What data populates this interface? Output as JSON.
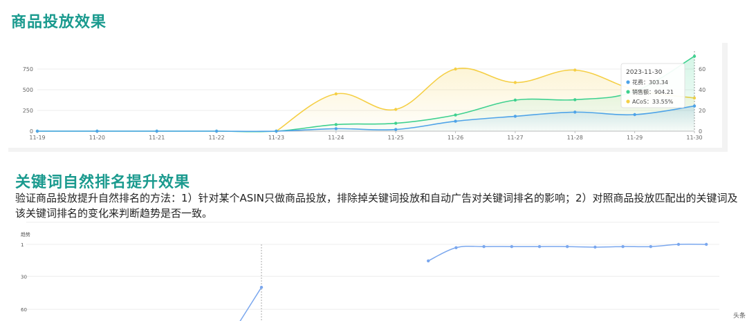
{
  "section1": {
    "title": "商品投放效果"
  },
  "section2": {
    "title": "关键词自然排名提升效果",
    "description": "验证商品投放提升自然排名的方法：1）针对某个ASIN只做商品投放，排除掉关键词投放和自动广告对关键词排名的影响；2）对照商品投放匹配出的关键词及该关键词排名的变化来判断趋势是否一致。"
  },
  "watermark": "头条",
  "colors": {
    "title": "#1a9a8e",
    "spend": "#4ea3e8",
    "sales": "#3ed18f",
    "acos": "#f5cf45",
    "rank": "#7aa7ee"
  },
  "chart_data": [
    {
      "type": "line",
      "categories": [
        "11-19",
        "11-20",
        "11-21",
        "11-22",
        "11-23",
        "11-24",
        "11-25",
        "11-26",
        "11-27",
        "11-28",
        "11-29",
        "11-30"
      ],
      "series": [
        {
          "name": "花费",
          "axis": "left",
          "color": "#4ea3e8",
          "values": [
            0,
            0,
            0,
            0,
            0,
            30,
            20,
            120,
            180,
            230,
            200,
            303.34
          ]
        },
        {
          "name": "销售额",
          "axis": "left",
          "color": "#3ed18f",
          "values": [
            0,
            0,
            0,
            0,
            0,
            80,
            95,
            195,
            375,
            380,
            480,
            904.21
          ]
        },
        {
          "name": "ACoS",
          "axis": "right",
          "color": "#f5cf45",
          "values": [
            null,
            null,
            null,
            null,
            0,
            36,
            21,
            60,
            47,
            59,
            40,
            32
          ]
        }
      ],
      "left_axis": {
        "ticks": [
          0,
          250,
          500,
          750
        ],
        "ylim": [
          0,
          900
        ]
      },
      "right_axis": {
        "ticks": [
          0,
          20,
          40,
          60
        ],
        "ylim": [
          0,
          72
        ]
      },
      "tooltip": {
        "date": "2023-11-30",
        "rows": [
          {
            "label": "花费：",
            "value": "303.34",
            "color": "#4ea3e8"
          },
          {
            "label": "销售额：",
            "value": "904.21",
            "color": "#3ed18f"
          },
          {
            "label": "ACoS：",
            "value": "33.55%",
            "color": "#f5cf45"
          }
        ]
      },
      "grid": true
    },
    {
      "type": "line",
      "ylabel": "趋势",
      "y_ticks": [
        1,
        30,
        60
      ],
      "ylim_inverted": [
        1,
        80
      ],
      "series": [
        {
          "name": "",
          "color": "#7aa7ee",
          "segment": "a",
          "points": [
            [
              0,
              80
            ],
            [
              1,
              40
            ]
          ]
        },
        {
          "name": "",
          "color": "#7aa7ee",
          "segment": "b",
          "points": [
            [
              7,
              16
            ],
            [
              8,
              4
            ],
            [
              9,
              3
            ],
            [
              10,
              3
            ],
            [
              11,
              3
            ],
            [
              12,
              3
            ],
            [
              13,
              3.5
            ],
            [
              14,
              3
            ],
            [
              15,
              3
            ],
            [
              16,
              1
            ],
            [
              17,
              1
            ]
          ]
        }
      ],
      "x_count": 18,
      "grid": true
    }
  ]
}
